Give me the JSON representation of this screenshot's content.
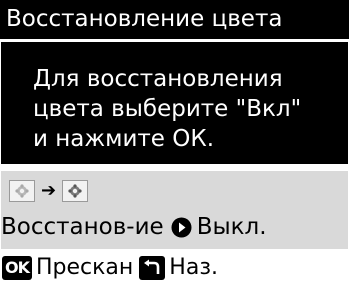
{
  "header": {
    "title": "Восстановление цвета"
  },
  "message": {
    "lines": [
      "Для восстановления",
      "цвета выберите \"Вкл\"",
      "и нажмите ОК."
    ]
  },
  "setting": {
    "icons": [
      "faded-photo-icon",
      "arrow-right-icon",
      "restored-photo-icon"
    ],
    "label": "Восстанов-ие",
    "value": "Выкл."
  },
  "footer": {
    "ok_key": "OK",
    "ok_label": "Прескан",
    "back_label": "Наз."
  },
  "colors": {
    "title_bg": "#000000",
    "panel_bg": "#d9d9d9",
    "text_light": "#ffffff",
    "text_dark": "#000000"
  }
}
